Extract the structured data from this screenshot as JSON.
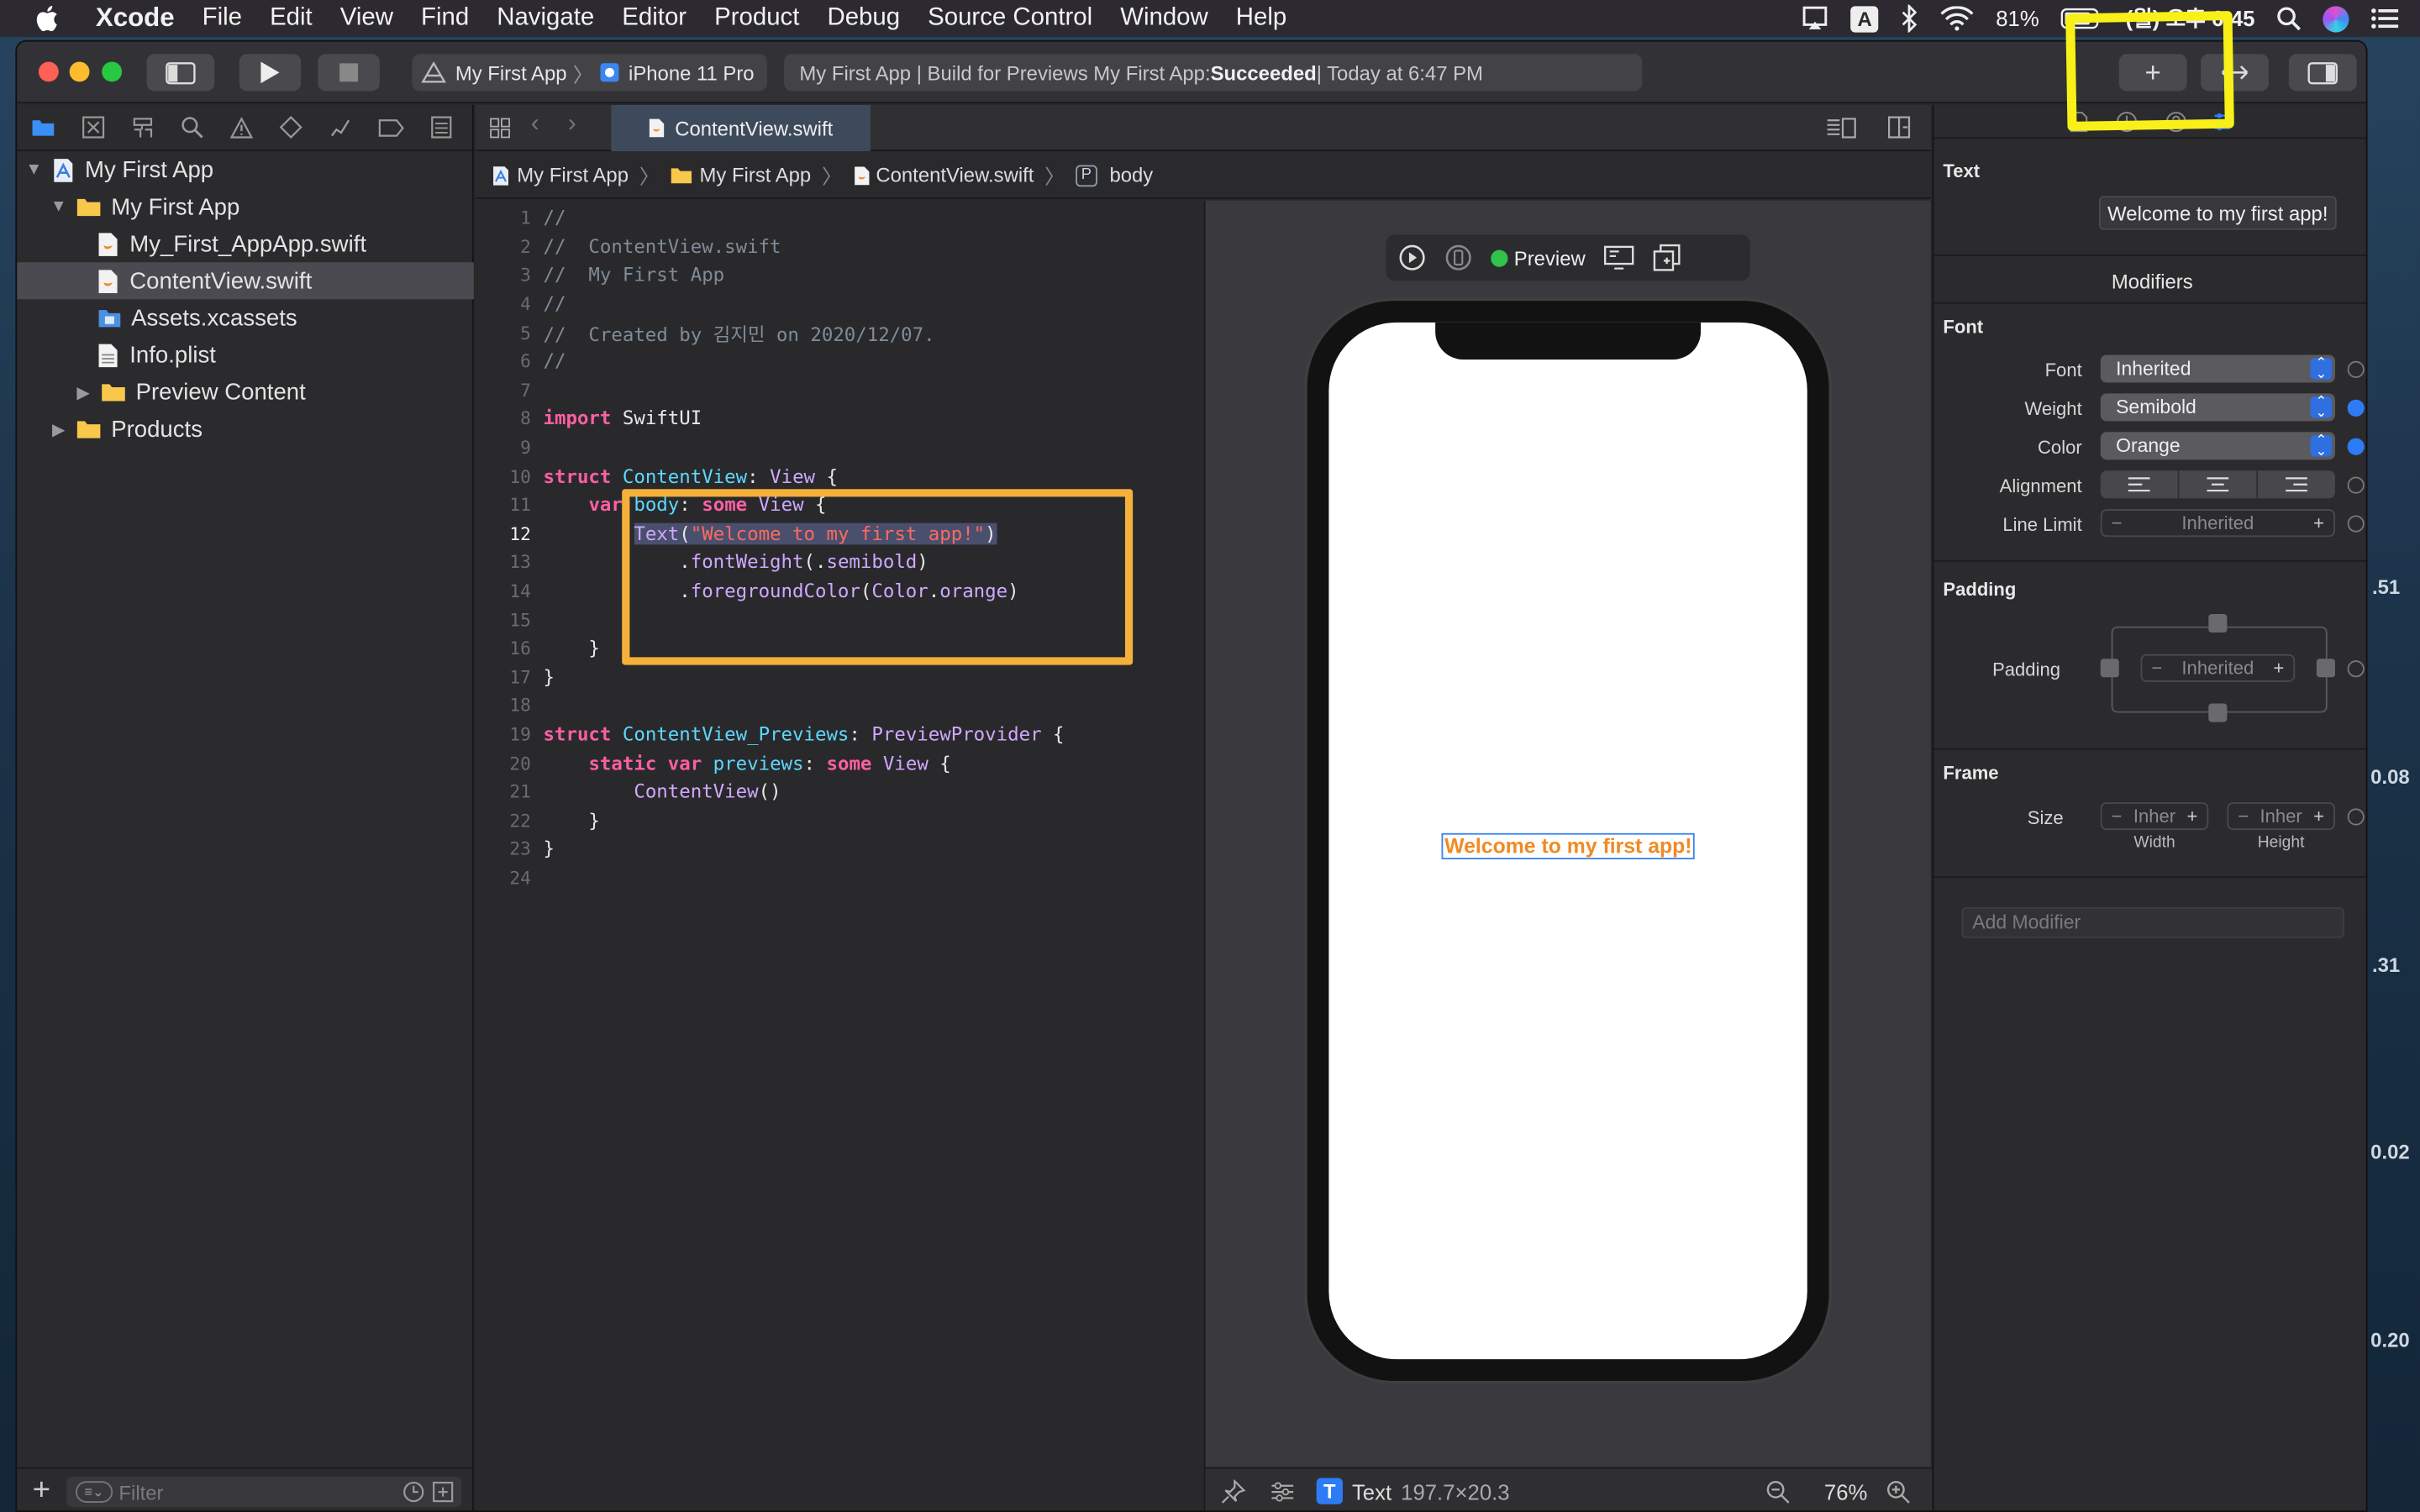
{
  "menubar": {
    "app_name": "Xcode",
    "items": [
      "File",
      "Edit",
      "View",
      "Find",
      "Navigate",
      "Editor",
      "Product",
      "Debug",
      "Source Control",
      "Window",
      "Help"
    ],
    "input_indicator": "A",
    "battery": "81%",
    "clock": "(월) 오후 6:45"
  },
  "toolbar": {
    "scheme_target": "My First App",
    "scheme_device": "iPhone 11 Pro",
    "activity_prefix": "My First App | Build for Previews My First App: ",
    "activity_status": "Succeeded",
    "activity_time": " | Today at 6:47 PM",
    "add_label": "+"
  },
  "navigator": {
    "items": [
      {
        "label": "My First App",
        "kind": "project"
      },
      {
        "label": "My First App",
        "kind": "folder"
      },
      {
        "label": "My_First_AppApp.swift",
        "kind": "swift"
      },
      {
        "label": "ContentView.swift",
        "kind": "swift",
        "selected": true
      },
      {
        "label": "Assets.xcassets",
        "kind": "assets"
      },
      {
        "label": "Info.plist",
        "kind": "plist"
      },
      {
        "label": "Preview Content",
        "kind": "folder"
      },
      {
        "label": "Products",
        "kind": "folder"
      }
    ],
    "filter_placeholder": "Filter"
  },
  "editor": {
    "tab_title": "ContentView.swift",
    "breadcrumb": [
      "My First App",
      "My First App",
      "ContentView.swift",
      "body"
    ],
    "current_line": "12",
    "lines": [
      {
        "n": "1",
        "t": "//"
      },
      {
        "n": "2",
        "t": "//  ContentView.swift"
      },
      {
        "n": "3",
        "t": "//  My First App"
      },
      {
        "n": "4",
        "t": "//"
      },
      {
        "n": "5",
        "t": "//  Created by 김지민 on 2020/12/07."
      },
      {
        "n": "6",
        "t": "//"
      },
      {
        "n": "7",
        "t": ""
      },
      {
        "n": "8",
        "t": "import SwiftUI"
      },
      {
        "n": "9",
        "t": ""
      },
      {
        "n": "10",
        "t": "struct ContentView: View {"
      },
      {
        "n": "11",
        "t": "    var body: some View {"
      },
      {
        "n": "12",
        "t": "        Text(\"Welcome to my first app!\")"
      },
      {
        "n": "13",
        "t": "            .fontWeight(.semibold)"
      },
      {
        "n": "14",
        "t": "            .foregroundColor(Color.orange)"
      },
      {
        "n": "15",
        "t": ""
      },
      {
        "n": "16",
        "t": "    }"
      },
      {
        "n": "17",
        "t": "}"
      },
      {
        "n": "18",
        "t": ""
      },
      {
        "n": "19",
        "t": "struct ContentView_Previews: PreviewProvider {"
      },
      {
        "n": "20",
        "t": "    static var previews: some View {"
      },
      {
        "n": "21",
        "t": "        ContentView()"
      },
      {
        "n": "22",
        "t": "    }"
      },
      {
        "n": "23",
        "t": "}"
      },
      {
        "n": "24",
        "t": ""
      }
    ]
  },
  "canvas": {
    "preview_label": "Preview",
    "preview_text": "Welcome to my first app!",
    "selected_kind": "Text",
    "selected_size": "197.7×20.3",
    "zoom": "76%"
  },
  "inspector": {
    "text_header": "Text",
    "text_value": "Welcome to my first app!",
    "modifiers_header": "Modifiers",
    "font_header": "Font",
    "font_label": "Font",
    "font_value": "Inherited",
    "weight_label": "Weight",
    "weight_value": "Semibold",
    "color_label": "Color",
    "color_value": "Orange",
    "alignment_label": "Alignment",
    "line_limit_label": "Line Limit",
    "line_limit_value": "Inherited",
    "padding_header": "Padding",
    "padding_label": "Padding",
    "padding_value": "Inherited",
    "frame_header": "Frame",
    "size_label": "Size",
    "width_value": "Inher",
    "height_value": "Inher",
    "width_caption": "Width",
    "height_caption": "Height",
    "add_modifier_placeholder": "Add Modifier"
  },
  "desktop_peek": [
    ".51",
    "0.08",
    ".31",
    "0.02",
    "0.20"
  ],
  "colors": {
    "accent": "#2d7cf6",
    "swift_orange": "#f08a24",
    "annotation_yellow": "#f8f018",
    "annotation_orange": "#f4b03a"
  }
}
